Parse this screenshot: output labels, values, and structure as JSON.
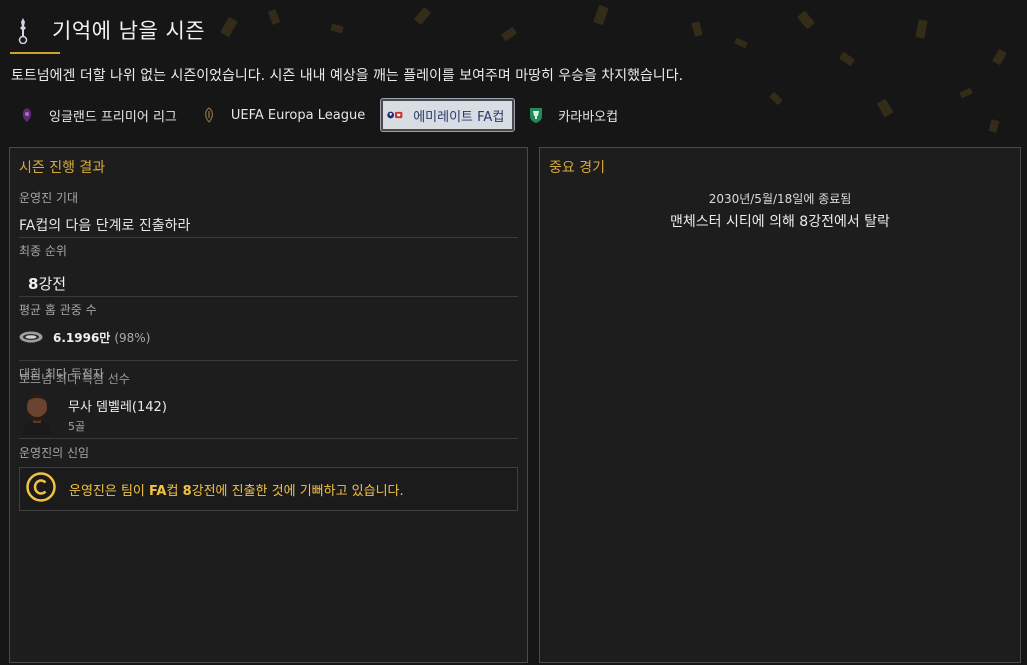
{
  "header": {
    "title": "기억에 남을 시즌",
    "club_icon": "spurs-cockerel-icon"
  },
  "subtitle": "토트넘에겐 더할 나위 없는 시즌이었습니다. 시즌 내내 예상을 깨는 플레이를 보여주며 마땅히 우승을 차지했습니다.",
  "tabs": [
    {
      "label": "잉글랜드 프리미어 리그",
      "icon": "premier-league-icon",
      "active": false
    },
    {
      "label": "UEFA Europa League",
      "icon": "europa-league-icon",
      "active": false
    },
    {
      "label": "에미레이트 FA컵",
      "icon": "fa-cup-icon",
      "active": true
    },
    {
      "label": "카라바오컵",
      "icon": "carabao-cup-icon",
      "active": false
    }
  ],
  "season": {
    "title": "시즌 진행 결과",
    "expectation_label": "운영진 기대",
    "expectation_value": "FA컵의 다음 단계로 진출하라",
    "final_position_label": "최종 순위",
    "final_position_value_num": "8",
    "final_position_value_text": "강전",
    "attendance_label": "평균 홈 관중 수",
    "attendance_value": "6.1996만",
    "attendance_pct": "(98%)",
    "top_scorer_label_a": "대회 최다 득점자",
    "top_scorer_label_b": "토트넘 최다 득점 선수",
    "top_scorer_name": "무사 뎀벨레(142)",
    "top_scorer_goals": "5골",
    "confidence_label": "운영진의 신임",
    "confidence_pre": "운영진은 팀이 ",
    "confidence_bold1": "FA",
    "confidence_mid1": "컵 ",
    "confidence_bold2": "8",
    "confidence_post": "강전에 진출한 것에 기뻐하고 있습니다."
  },
  "matches": {
    "title": "중요 경기",
    "date_text": "2030년/5월/18일에 종료됨",
    "result_text": "맨체스터 시티에 의해 8강전에서 탈락"
  },
  "colors": {
    "accent": "#d9a93c",
    "confidence": "#f2c243",
    "background": "#161616"
  }
}
